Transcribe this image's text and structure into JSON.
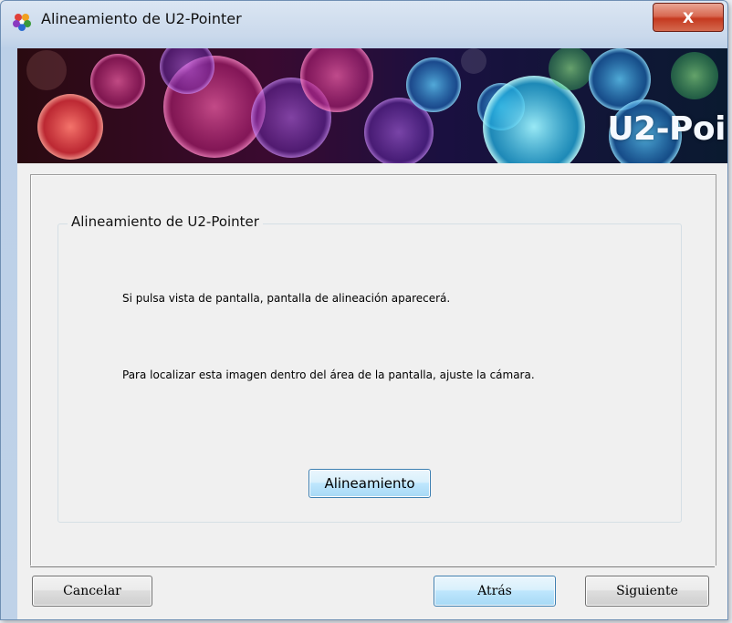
{
  "window": {
    "title": "Alineamiento de U2-Pointer",
    "close_label": "X"
  },
  "banner": {
    "text": "U2-Poi"
  },
  "group": {
    "title": "Alineamiento de U2-Pointer",
    "message1": "Si pulsa vista de pantalla, pantalla de alineación aparecerá.",
    "message2": "Para localizar esta imagen dentro del área de la pantalla, ajuste la cámara.",
    "align_button": "Alineamiento"
  },
  "footer": {
    "cancel_label": "Cancelar",
    "back_label": "Atrás",
    "next_label": "Siguiente"
  },
  "colors": {
    "title_bar": "#c9d8eb",
    "close_button": "#c5391f",
    "panel": "#f0f0f0",
    "focus_button": "#a7d9f5"
  },
  "icons": {
    "app": "colorful-flower-icon",
    "close": "close-icon"
  }
}
